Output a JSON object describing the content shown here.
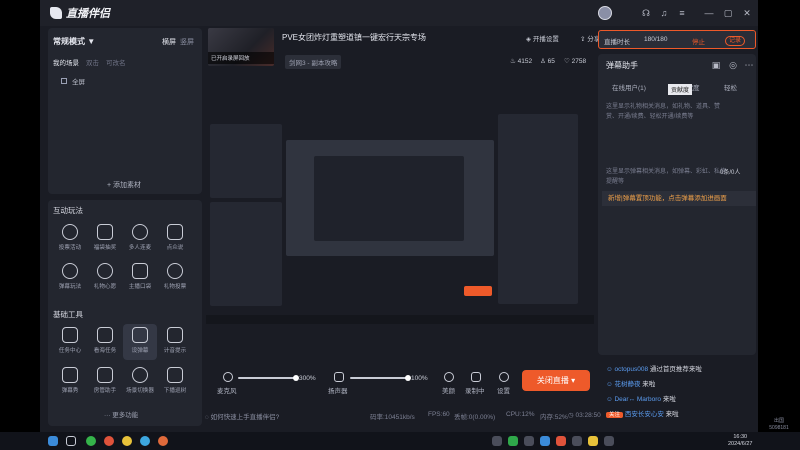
{
  "app": {
    "title": "直播伴侣"
  },
  "left": {
    "mode": "常规模式 ▼",
    "mode_tabs": [
      "横屏",
      "竖屏"
    ],
    "scene_tabs": [
      "我的场景",
      "双击",
      "可改名"
    ],
    "source": "全屏",
    "add_source": "+ 添加素材",
    "interactive_title": "互动玩法",
    "interactive_tools": [
      "投票活动",
      "福袋抽奖",
      "多人连麦",
      "点众说",
      "弹幕玩法",
      "礼物心愿",
      "主播口袋",
      "礼物投票"
    ],
    "basic_title": "基础工具",
    "basic_tools": [
      "任务中心",
      "看海任务",
      "设弹幕",
      "计音提示",
      "弹幕秀",
      "房管助手",
      "场景切换器",
      "下播巡树"
    ],
    "more": "··· 更多功能"
  },
  "header": {
    "thumb_label": "已开启录屏回放",
    "title": "PVE女团炸灯重塑道镇一键宏行天宗专场",
    "category": "剑网3 - 副本攻略",
    "share_btn": "开播设置",
    "share": "分享",
    "stat_viewers": "4152",
    "stat_likes": "65",
    "stat_fans": "2758"
  },
  "controls": {
    "mic_label": "麦克风",
    "mic_pct": "300%",
    "speaker_label": "扬声器",
    "speaker_pct": "100%",
    "beauty": "美颜",
    "record": "录制中",
    "settings": "设置",
    "live_btn": "关闭直播 ▾",
    "help": "如何快速上手直播伴侣?",
    "status_bitrate": "码率:10451kb/s",
    "status_fps": "FPS:60",
    "status_drop": "丢帧:0(0.00%)",
    "status_cpu": "CPU:12%",
    "status_mem": "内存:52%",
    "status_time": "03:28:50"
  },
  "right": {
    "timer_label": "直播时长",
    "timer_val": "180/180",
    "timer_red": "停止",
    "timer_more": "记录",
    "dm_title": "弹幕助手",
    "dm_tabs": [
      "在线用户(1)",
      "贡献度",
      "轻松"
    ],
    "tooltip": "贡献度",
    "dm_desc1": "这里显示礼物相关消息，如礼物、道具、赞赏、开通/续费、轻松开通/续费等",
    "dm_desc2": "这里显示弹幕相关消息，如弹幕、彩虹、私信提醒等",
    "dm_count": "0条/0人",
    "dm_banner": "新增|弹幕置顶功能，点击弹幕添加进画面",
    "msgs": [
      {
        "user": "octopus008",
        "text": "通过首页推荐来啦"
      },
      {
        "user": "花树静夜",
        "text": "来啦"
      },
      {
        "user": "Dear↔ Marboro",
        "text": "来啦"
      },
      {
        "badge": "关注",
        "user": "西安长安心安",
        "text": "来啦"
      }
    ]
  },
  "taskbar": {
    "time": "16:30",
    "date": "2024/6/27"
  },
  "corner": {
    "line1": "出国",
    "line2": "5098181"
  },
  "colors": {
    "accent": "#ee5a2a",
    "bg": "#1a1c24",
    "panel": "#23262f"
  }
}
